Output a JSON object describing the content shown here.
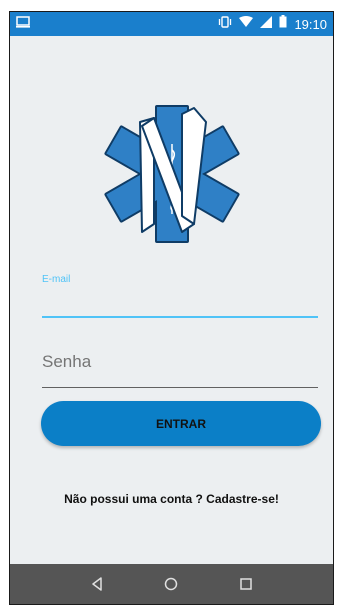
{
  "status_bar": {
    "time": "19:10",
    "background": "#1a7fcc",
    "icons": [
      "screen-cast-icon",
      "vibrate-icon",
      "wifi-icon",
      "signal-icon",
      "battery-icon"
    ]
  },
  "logo": {
    "icon": "star-of-life-n-logo"
  },
  "email": {
    "label": "E-mail",
    "value": ""
  },
  "password": {
    "placeholder": "Senha",
    "value": ""
  },
  "login_button": {
    "label": "ENTRAR",
    "color": "#0b7fc7"
  },
  "signup": {
    "text": "Não possui uma conta ? Cadastre-se!"
  },
  "nav_bar": {
    "background": "#555555",
    "buttons": [
      "back-icon",
      "home-icon",
      "recents-icon"
    ]
  }
}
